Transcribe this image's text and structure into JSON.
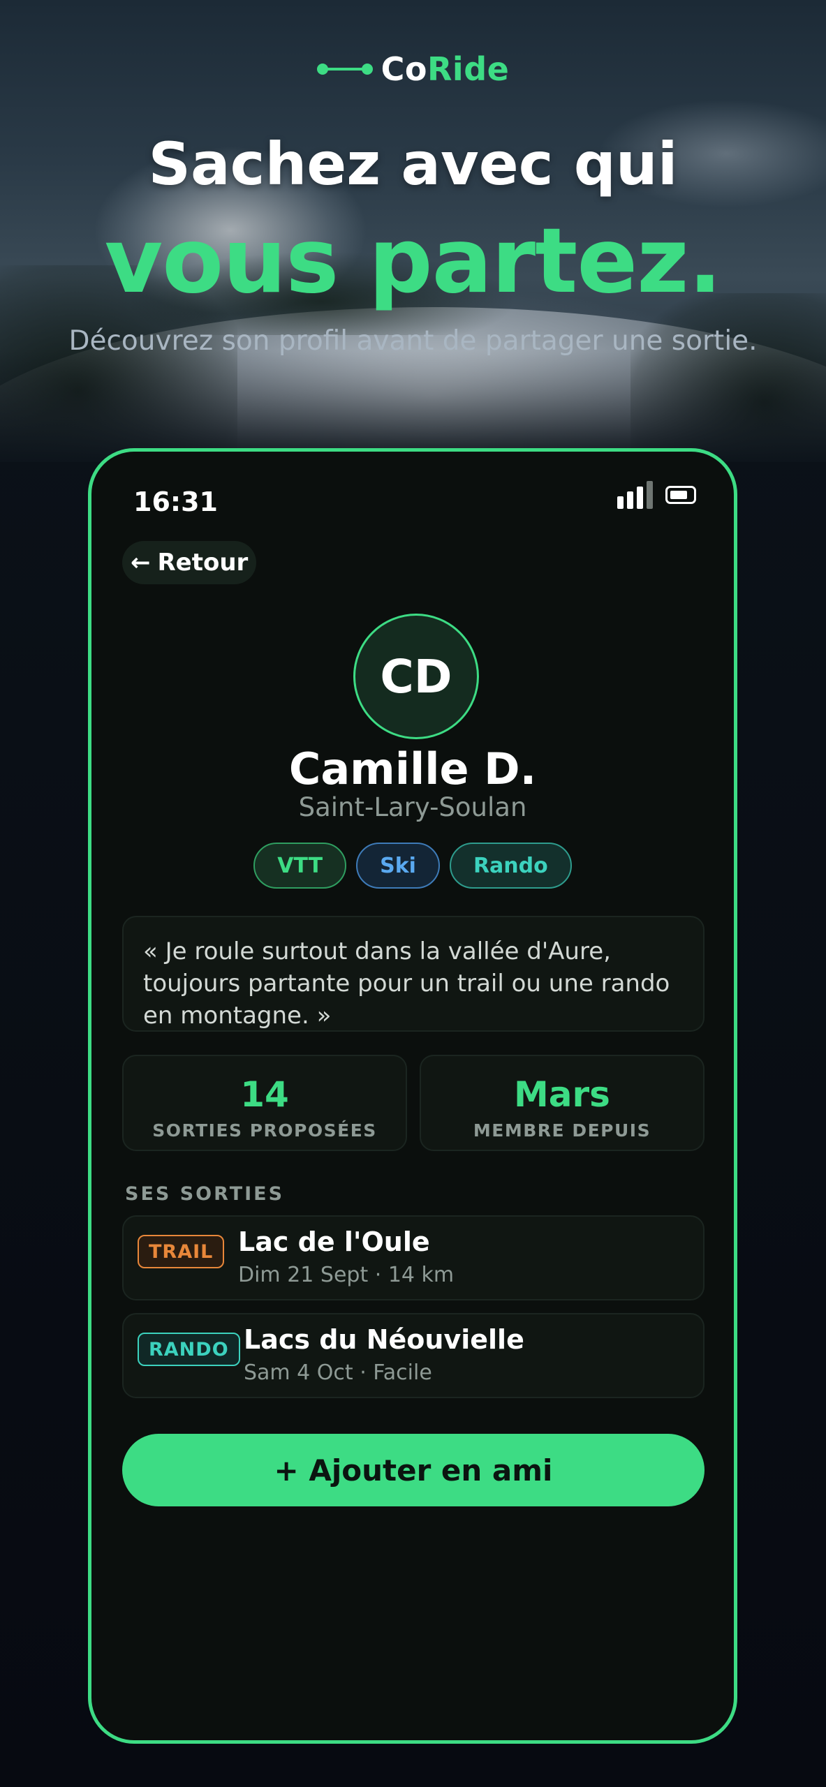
{
  "brand": {
    "name_part1": "Co",
    "name_part2": "Ride",
    "logo_icon": "route-dots-icon",
    "accent_color": "#3ddc84"
  },
  "hero": {
    "headline_line1": "Sachez avec qui",
    "headline_line2": "vous partez.",
    "subtitle": "Découvrez son profil avant de partager une sortie."
  },
  "phone": {
    "status_bar": {
      "time": "16:31",
      "icons": [
        "signal-icon",
        "battery-icon"
      ]
    },
    "back_button": {
      "arrow": "←",
      "label": "Retour"
    },
    "profile": {
      "initials": "CD",
      "name": "Camille D.",
      "location": "Saint-Lary-Soulan",
      "tags": [
        {
          "label": "VTT",
          "color": "#3ddc84"
        },
        {
          "label": "Ski",
          "color": "#5aa9f0"
        },
        {
          "label": "Rando",
          "color": "#3cd2be"
        }
      ],
      "bio": "« Je roule surtout dans la vallée d'Aure, toujours partante pour un trail ou une rando en montagne. »"
    },
    "stats": [
      {
        "value": "14",
        "label": "SORTIES PROPOSÉES"
      },
      {
        "value": "Mars",
        "label": "MEMBRE DEPUIS"
      }
    ],
    "rides_section_title": "SES SORTIES",
    "rides": [
      {
        "badge": "TRAIL",
        "badge_color": "#e8873a",
        "title": "Lac de l'Oule",
        "meta": "Dim 21 Sept · 14 km"
      },
      {
        "badge": "RANDO",
        "badge_color": "#3cd2be",
        "title": "Lacs du Néouvielle",
        "meta": "Sam 4 Oct · Facile"
      }
    ],
    "add_friend_button": "+ Ajouter en ami"
  }
}
